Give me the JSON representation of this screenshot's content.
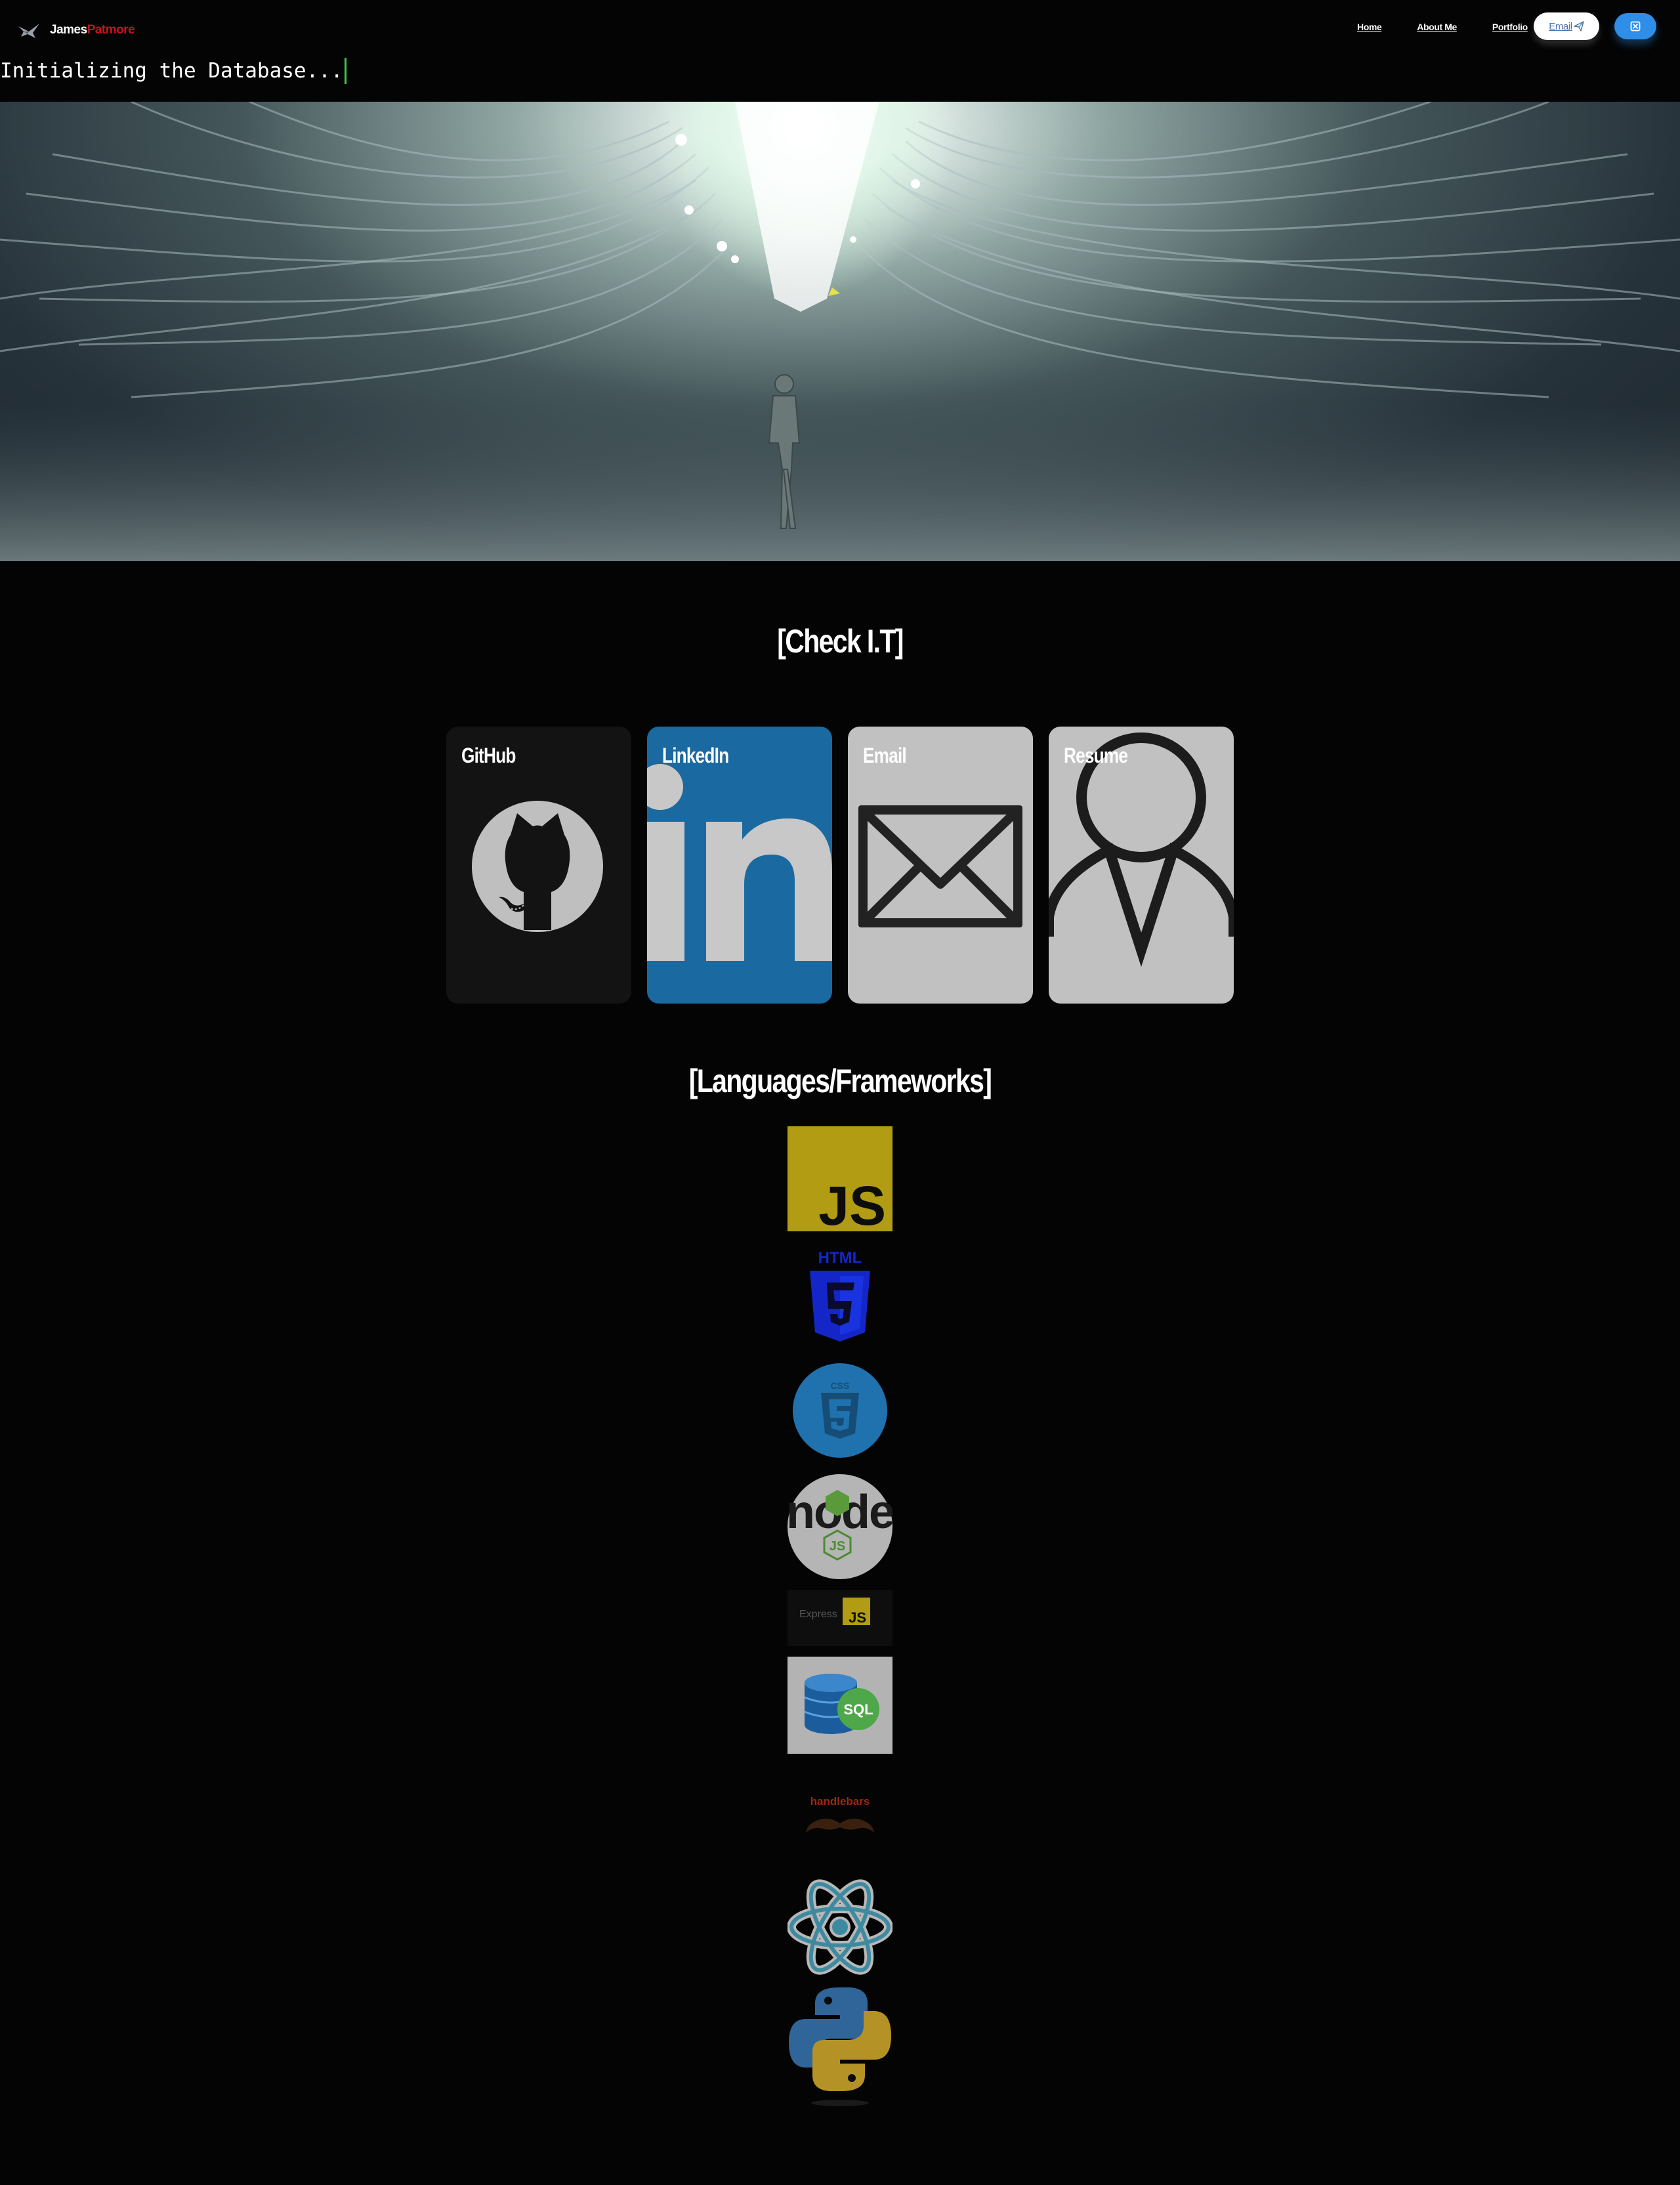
{
  "brand": {
    "first": "James",
    "last": "Patmore"
  },
  "nav": {
    "home": "Home",
    "about": "About Me",
    "portfolio": "Portfolio",
    "email_button": "Email"
  },
  "typewriter": {
    "text": "Initializing the Database..."
  },
  "sections": {
    "links_title": "[Check I.T]",
    "languages_title": "[Languages/Frameworks]"
  },
  "cards": [
    {
      "label": "GitHub",
      "icon": "github-icon"
    },
    {
      "label": "LinkedIn",
      "icon": "linkedin-icon"
    },
    {
      "label": "Email",
      "icon": "envelope-icon"
    },
    {
      "label": "Resume",
      "icon": "person-icon"
    }
  ],
  "tech_logos": {
    "js": "JS",
    "html": "HTML",
    "css": "CSS",
    "node": "node",
    "node_js": "JS",
    "express": "Express",
    "express_js": "JS",
    "sql": "SQL",
    "handlebars": "handlebars"
  },
  "colors": {
    "background": "#040404",
    "brand_accent": "#c5141e",
    "cursor": "#3fc84a",
    "email_button_bg": "#ffffff",
    "x_button_bg": "#2f8ee8",
    "linkedin_blue": "#1a6aa1",
    "card_grey": "#c1c1c1"
  }
}
